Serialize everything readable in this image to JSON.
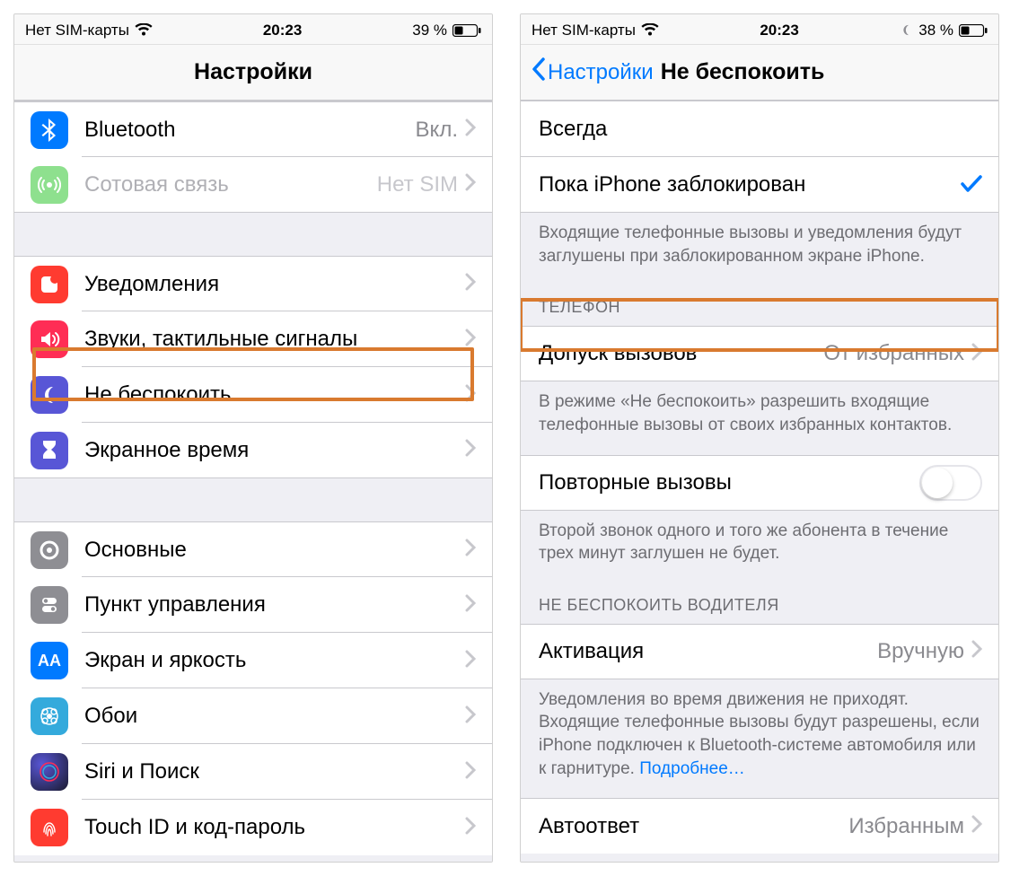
{
  "left": {
    "status": {
      "carrier": "Нет SIM-карты",
      "time": "20:23",
      "battery_pct": "39 %"
    },
    "title": "Настройки",
    "rows": {
      "bluetooth": {
        "label": "Bluetooth",
        "value": "Вкл."
      },
      "cellular": {
        "label": "Сотовая связь",
        "value": "Нет SIM"
      },
      "notifications": {
        "label": "Уведомления"
      },
      "sounds": {
        "label": "Звуки, тактильные сигналы"
      },
      "dnd": {
        "label": "Не беспокоить"
      },
      "screentime": {
        "label": "Экранное время"
      },
      "general": {
        "label": "Основные"
      },
      "control": {
        "label": "Пункт управления"
      },
      "display": {
        "label": "Экран и яркость"
      },
      "wallpaper": {
        "label": "Обои"
      },
      "siri": {
        "label": "Siri и Поиск"
      },
      "touchid": {
        "label": "Touch ID и код-пароль"
      }
    }
  },
  "right": {
    "status": {
      "carrier": "Нет SIM-карты",
      "time": "20:23",
      "battery_pct": "38 %"
    },
    "back": "Настройки",
    "title": "Не беспокоить",
    "silence": {
      "always": "Всегда",
      "locked": "Пока iPhone заблокирован",
      "footer": "Входящие телефонные вызовы и уведомления будут заглушены при заблокированном экране iPhone."
    },
    "phone": {
      "header": "ТЕЛЕФОН",
      "allow_calls": {
        "label": "Допуск вызовов",
        "value": "От избранных"
      },
      "allow_footer": "В режиме «Не беспокоить» разрешить входящие телефонные вызовы от своих избранных контактов.",
      "repeated": {
        "label": "Повторные вызовы"
      },
      "repeated_footer": "Второй звонок одного и того же абонента в течение трех минут заглушен не будет."
    },
    "driving": {
      "header": "НЕ БЕСПОКОИТЬ ВОДИТЕЛЯ",
      "activation": {
        "label": "Активация",
        "value": "Вручную"
      },
      "footer_text": "Уведомления во время движения не приходят. Входящие телефонные вызовы будут разрешены, если iPhone подключен к Bluetooth-системе автомобиля или к гарнитуре. ",
      "footer_link": "Подробнее…",
      "autoreply": {
        "label": "Автоответ",
        "value": "Избранным"
      }
    }
  },
  "colors": {
    "blue": "#007aff",
    "highlight": "#d97a2f"
  }
}
